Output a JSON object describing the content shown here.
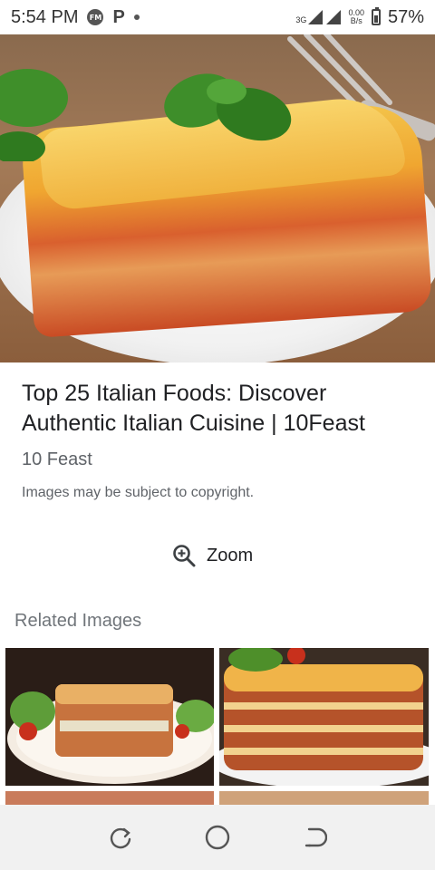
{
  "status_bar": {
    "time": "5:54 PM",
    "notif_icon_label": "FM",
    "p_icon_label": "P",
    "network_type": "3G",
    "net_speed_value": "0.00",
    "net_speed_unit": "B/s",
    "battery_percent": "57%"
  },
  "result": {
    "title": "Top 25 Italian Foods: Discover Authentic Italian Cuisine | 10Feast",
    "source": "10 Feast",
    "copyright_notice": "Images may be subject to copyright.",
    "zoom_label": "Zoom"
  },
  "related": {
    "heading": "Related Images"
  },
  "icons": {
    "zoom": "zoom-in-icon",
    "recent_apps": "recent-apps-icon",
    "home": "home-icon",
    "back": "back-icon"
  }
}
